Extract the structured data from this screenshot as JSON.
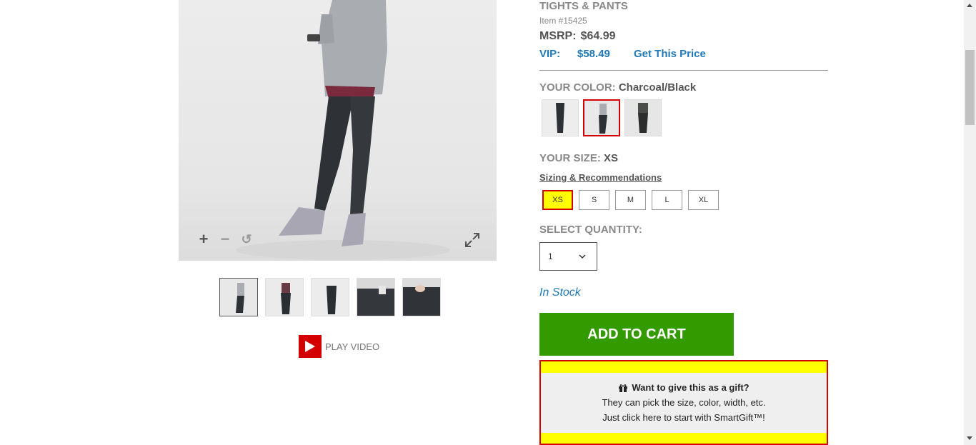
{
  "product": {
    "category": "TIGHTS & PANTS",
    "item_number": "Item #15425",
    "msrp_label": "MSRP:",
    "msrp_value": "$64.99",
    "vip_label": "VIP:",
    "vip_value": "$58.49",
    "vip_link": "Get This Price"
  },
  "color": {
    "label": "YOUR COLOR:",
    "value": "Charcoal/Black",
    "swatches": [
      "light",
      "charcoal-selected",
      "dark"
    ]
  },
  "size": {
    "label": "YOUR SIZE:",
    "value": "XS",
    "link": "Sizing & Recommendations",
    "options": [
      "XS",
      "S",
      "M",
      "L",
      "XL"
    ]
  },
  "quantity": {
    "label": "SELECT QUANTITY:",
    "value": "1"
  },
  "stock": "In Stock",
  "add_to_cart": "ADD TO CART",
  "gift": {
    "title": "Want to give this as a gift?",
    "line1": "They can pick the size, color, width, etc.",
    "line2": "Just click here to start with SmartGift™!"
  },
  "gallery": {
    "zoom_in": "+",
    "zoom_out": "−",
    "reset": "↺",
    "play_video": "PLAY VIDEO"
  },
  "colors": {
    "accent_blue": "#1f79b8",
    "cart_green": "#339a00",
    "highlight_red": "#d40000",
    "highlight_yellow": "#ffff00"
  }
}
